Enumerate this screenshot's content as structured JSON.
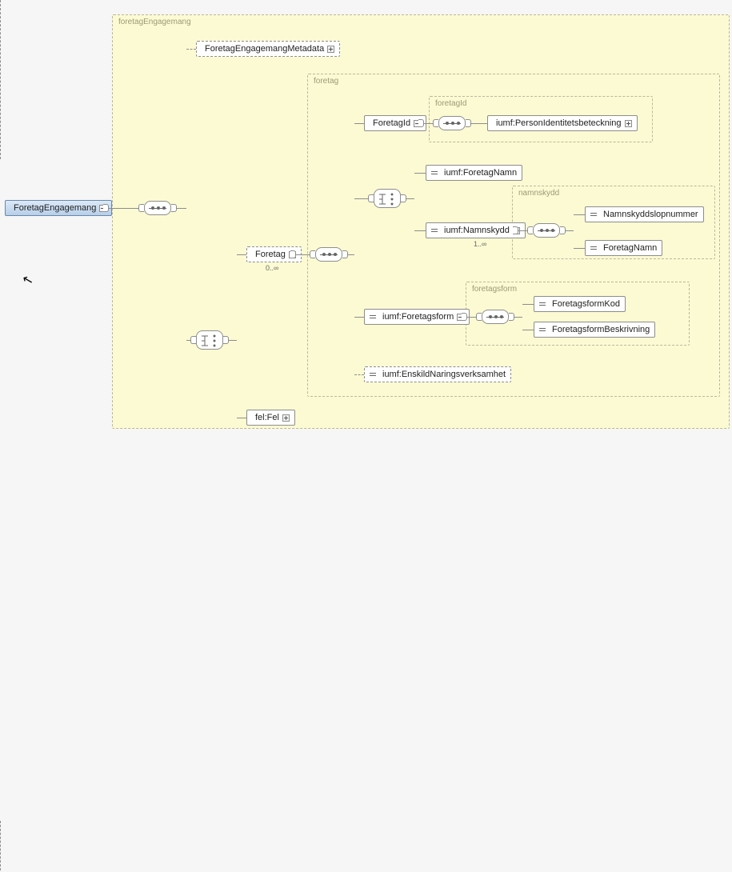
{
  "root": {
    "label": "ForetagEngagemang"
  },
  "groups": {
    "main": "foretagEngagemang",
    "foretag": "foretag",
    "foretagId": "foretagId",
    "namnskydd": "namnskydd",
    "foretagsform": "foretagsform"
  },
  "nodes": {
    "metadata": "ForetagEngagemangMetadata",
    "foretag": "Foretag",
    "felFel": "fel:Fel",
    "foretagId": "ForetagId",
    "personIdent": "iumf:PersonIdentitetsbeteckning",
    "foretagNamn": "iumf:ForetagNamn",
    "namnskydd": "iumf:Namnskydd",
    "namnskyddslop": "Namnskyddslopnummer",
    "foretagNamn2": "ForetagNamn",
    "foretagsform": "iumf:Foretagsform",
    "foretagsformKod": "ForetagsformKod",
    "foretagsformBeskr": "ForetagsformBeskrivning",
    "enskild": "iumf:EnskildNaringsverksamhet"
  },
  "cards": {
    "foretag": "0..∞",
    "namnskydd": "1..∞"
  }
}
